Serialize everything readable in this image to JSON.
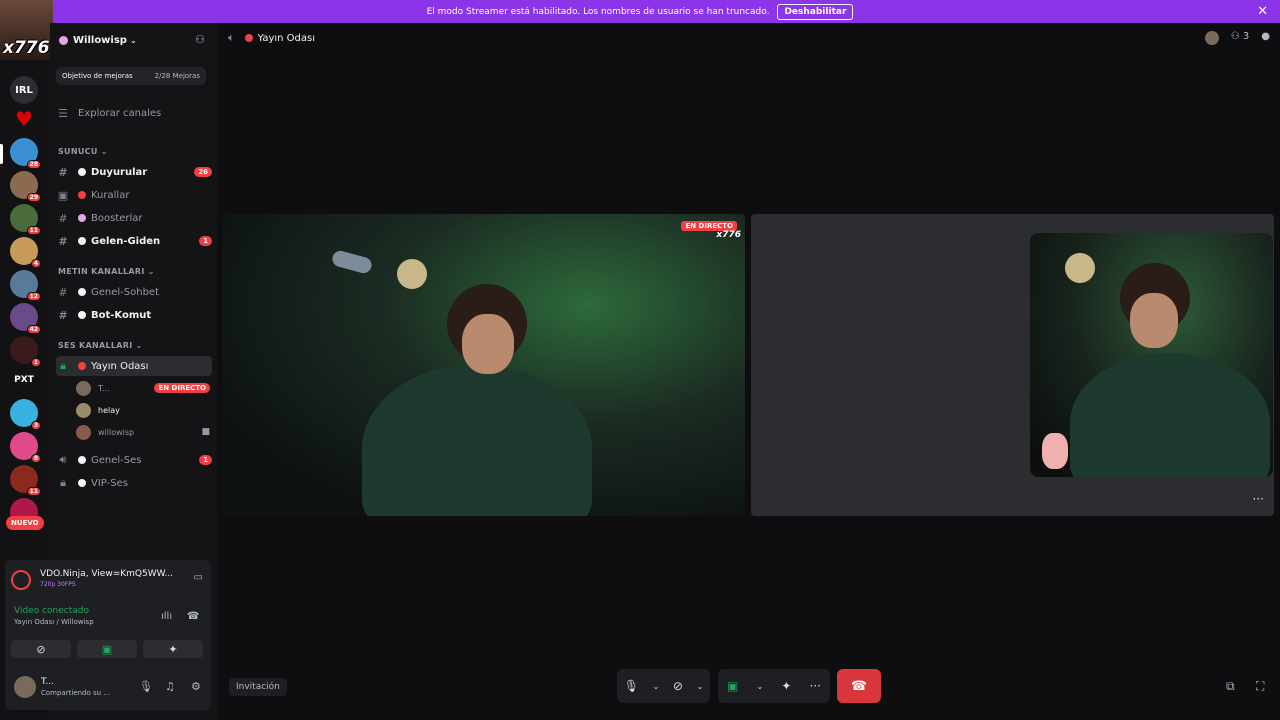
{
  "banner": {
    "text": "El modo Streamer está habilitado. Los nombres de usuario se han truncado.",
    "button": "Deshabilitar"
  },
  "guilds": {
    "logo_text": "x776",
    "items": [
      {
        "label": "IRL",
        "badge": ""
      },
      {
        "label": "♥",
        "badge": ""
      },
      {
        "label": "",
        "badge": "28"
      },
      {
        "label": "",
        "badge": "29"
      },
      {
        "label": "",
        "badge": "11"
      },
      {
        "label": "",
        "badge": "4"
      },
      {
        "label": "",
        "badge": "12"
      },
      {
        "label": "",
        "badge": "42"
      },
      {
        "label": "",
        "badge": "1"
      },
      {
        "label": "PXT",
        "badge": ""
      },
      {
        "label": "",
        "badge": "3"
      },
      {
        "label": "",
        "badge": "8"
      },
      {
        "label": "",
        "badge": "11"
      },
      {
        "label": "",
        "badge": ""
      }
    ],
    "new_label": "NUEVO"
  },
  "server": {
    "name": "Willowisp",
    "boost_goal": "Objetivo de mejoras",
    "boost_count": "2/28 Mejoras",
    "explore": "Explorar canales",
    "categories": {
      "sunucu": "SUNUCU",
      "metin": "METIN KANALLARI",
      "ses": "SES KANALLARI"
    },
    "channels": {
      "duyurular": {
        "name": "Duyurular",
        "badge": "26"
      },
      "kurallar": {
        "name": "Kurallar"
      },
      "boosterlar": {
        "name": "Boosterlar"
      },
      "gelen_giden": {
        "name": "Gelen-Giden",
        "badge": "1"
      },
      "genel_sohbet": {
        "name": "Genel-Sohbet"
      },
      "bot_komut": {
        "name": "Bot-Komut"
      },
      "yayin_odasi": {
        "name": "Yayın Odası"
      },
      "genel_ses": {
        "name": "Genel-Ses",
        "badge": "1"
      },
      "vip_ses": {
        "name": "VIP-Ses"
      }
    },
    "voice_users": [
      {
        "name": "T...",
        "live": "EN DIRECTO"
      },
      {
        "name": "helay"
      },
      {
        "name": "willowisp"
      }
    ]
  },
  "panel": {
    "activity_title": "VDO.Ninja, View=KmQ5WW...",
    "activity_sub": "720p 30FPS",
    "video_status": "Video conectado",
    "video_location": "Yayın Odası / Willowisp",
    "account_name": "T...",
    "account_status": "Compartiendo su ..."
  },
  "topbar": {
    "channel": "Yayın Odası",
    "member_count": "3"
  },
  "stage": {
    "live_badge": "EN DIRECTO",
    "watermark": "x776"
  },
  "controls": {
    "invite": "Invitación"
  },
  "colors": {
    "banner": "#8b34e8",
    "live": "#f23f43",
    "connected": "#23a55a",
    "hangup": "#da373c"
  }
}
